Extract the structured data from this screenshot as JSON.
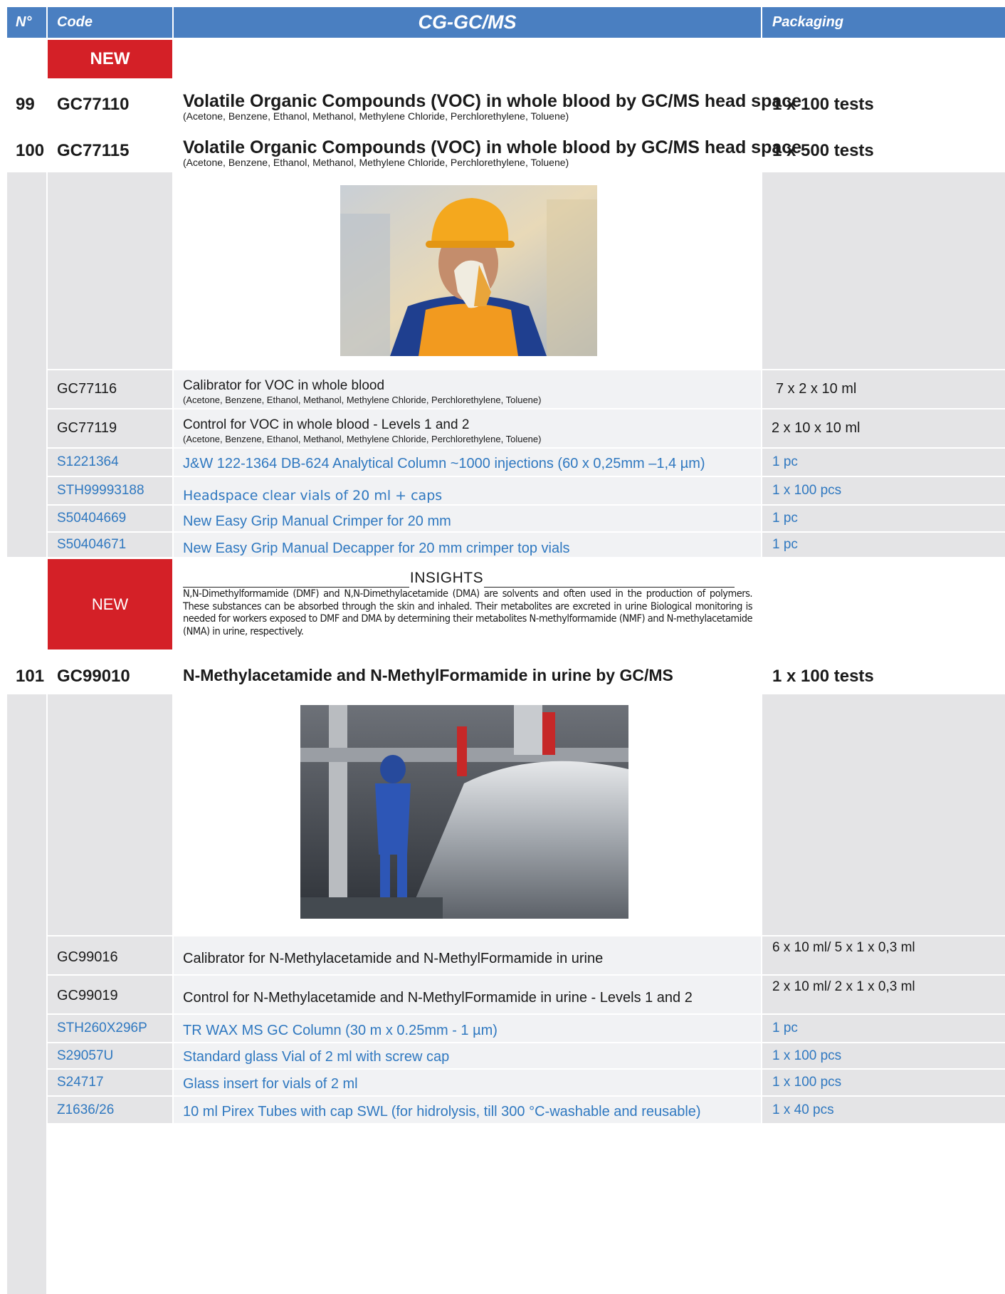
{
  "header": {
    "num": "N°",
    "code": "Code",
    "title": "CG-GC/MS",
    "packaging": "Packaging"
  },
  "badges": {
    "new1": "NEW",
    "new2": "NEW"
  },
  "products": [
    {
      "num": "99",
      "code": "GC77110",
      "title": "Volatile Organic Compounds (VOC) in whole blood by GC/MS head space",
      "subtitle": "(Acetone, Benzene, Ethanol, Methanol, Methylene Chloride, Perchlorethylene, Toluene)",
      "packaging": "1 x 100 tests"
    },
    {
      "num": "100",
      "code": "GC77115",
      "title": "Volatile Organic Compounds (VOC) in whole blood by GC/MS head space",
      "subtitle": "(Acetone, Benzene, Ethanol, Methanol, Methylene Chloride, Perchlorethylene, Toluene)",
      "packaging": "1 x 500 tests"
    },
    {
      "num": "101",
      "code": "GC99010",
      "title": "N-Methylacetamide and N-MethylFormamide in urine by GC/MS",
      "packaging": "1 x 100 tests"
    }
  ],
  "group1": [
    {
      "code": "GC77116",
      "desc": "Calibrator for VOC in whole blood",
      "sub": "(Acetone, Benzene, Ethanol, Methanol, Methylene Chloride, Perchlorethylene, Toluene)",
      "pack": "7 x 2 x 10 ml"
    },
    {
      "code": "GC77119",
      "desc": "Control for VOC in whole blood - Levels 1 and 2",
      "sub": "(Acetone, Benzene, Ethanol, Methanol, Methylene Chloride, Perchlorethylene, Toluene)",
      "pack": "2 x 10 x 10 ml"
    },
    {
      "code": "S1221364",
      "desc": "J&W 122-1364 DB-624 Analytical Column ~1000  injections (60 x 0,25mm –1,4 µm)",
      "pack": "1 pc"
    },
    {
      "code": "STH99993188",
      "desc": "Headspace clear vials of 20 ml + caps",
      "pack": "1 x 100 pcs"
    },
    {
      "code": "S50404669",
      "desc": "New Easy Grip Manual Crimper for 20 mm",
      "pack": "1 pc"
    },
    {
      "code": "S50404671",
      "desc": "New Easy Grip Manual Decapper for 20 mm crimper top vials",
      "pack": "1 pc"
    }
  ],
  "insights": {
    "title": "INSIGHTS",
    "text": "N,N-Dimethylformamide (DMF) and N,N-Dimethylacetamide (DMA) are solvents and often used in the production of polymers. These substances can be absorbed through the skin and inhaled. Their metabolites are excreted in urine Biological monitoring is needed for workers exposed to DMF and DMA by determining their metabolites N-methylformamide (NMF) and N-methylacetamide (NMA) in urine, respectively."
  },
  "group2": [
    {
      "code": "GC99016",
      "desc": "Calibrator for N-Methylacetamide and N-MethylFormamide in urine",
      "pack": "6 x 10 ml/ 5 x 1 x 0,3 ml"
    },
    {
      "code": "GC99019",
      "desc": "Control for N-Methylacetamide and N-MethylFormamide in urine - Levels 1 and 2",
      "pack": "2 x 10 ml/ 2 x 1 x 0,3 ml"
    },
    {
      "code": "STH260X296P",
      "desc": "TR WAX MS GC Column (30 m x 0.25mm - 1 µm)",
      "pack": "1 pc"
    },
    {
      "code": "S29057U",
      "desc": "Standard glass Vial of 2 ml with screw cap",
      "pack": "1 x 100 pcs"
    },
    {
      "code": "S24717",
      "desc": "Glass insert for vials of 2 ml",
      "pack": "1 x 100 pcs"
    },
    {
      "code": "Z1636/26",
      "desc": "10 ml Pirex Tubes with cap SWL (for hidrolysis, till 300 °C-washable and reusable)",
      "pack": "1 x 40 pcs"
    }
  ],
  "colors": {
    "header": "#4a7fc1",
    "new": "#d42027",
    "accessory_text": "#2f78c0",
    "panel_gray": "#e4e4e6",
    "row_light": "#f1f2f4"
  }
}
